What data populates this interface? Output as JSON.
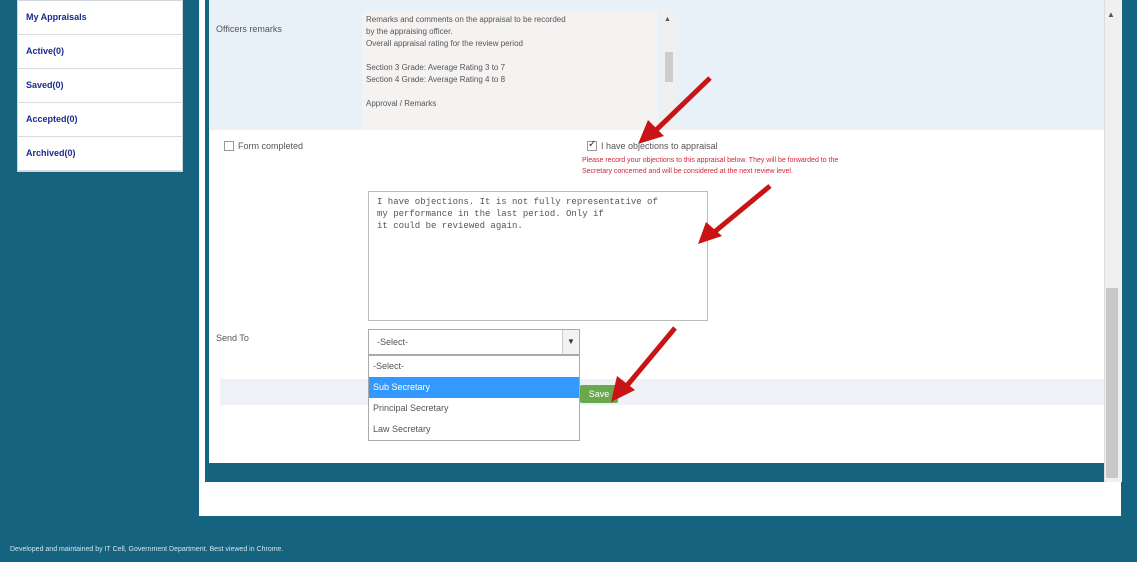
{
  "left_menu": {
    "items": [
      "My Appraisals",
      "Active(0)",
      "Saved(0)",
      "Accepted(0)",
      "Archived(0)"
    ]
  },
  "form": {
    "officers_label": "Officers remarks",
    "notes_lines": [
      "Remarks and comments on the appraisal to be recorded",
      "by the appraising officer.",
      "Overall appraisal rating for the review period",
      "",
      "Section 3 Grade: Average Rating 3 to 7",
      "Section 4 Grade: Average Rating 4 to 8",
      "",
      "Approval / Remarks"
    ],
    "left_check_label": "Form completed",
    "agree_label": "I have objections to appraisal",
    "warning_lines": [
      "Please record your objections to this appraisal below. They will be forwarded to the",
      "Secretary concerned and will be considered at the next review level."
    ],
    "comments": "I have objections. It is not fully representative of\nmy performance in the last period. Only if\nit could be reviewed again.",
    "send_label": "Send To",
    "select_value": "-Select-",
    "options": [
      "-Select-",
      "Sub Secretary",
      "Principal Secretary",
      "Law Secretary"
    ],
    "save_label": "Save"
  },
  "footer": {
    "text": "Developed and maintained by IT Cell, Government Department. Best viewed in Chrome."
  }
}
